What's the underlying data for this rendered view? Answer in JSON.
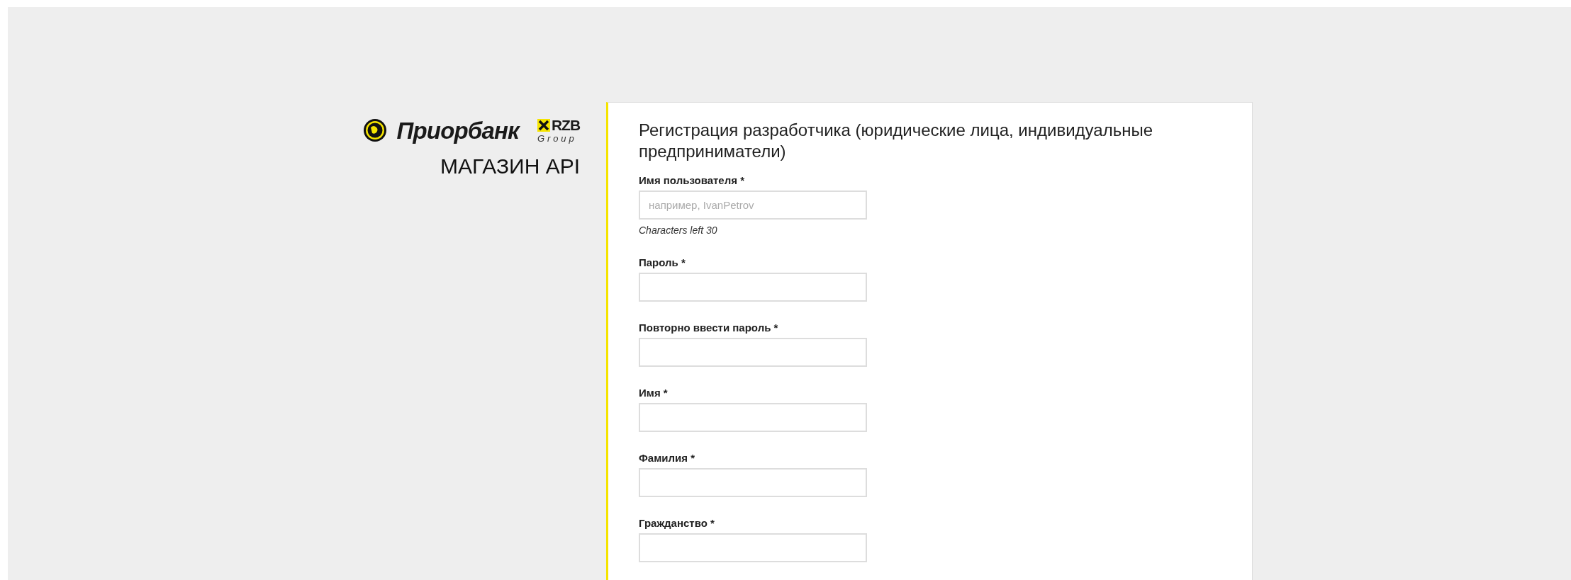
{
  "brand": {
    "name": "Приорбанк",
    "partner": "RZB",
    "partner_sub": "Group",
    "store_title": "МАГАЗИН API"
  },
  "form": {
    "title": "Регистрация разработчика (юридические лица, индивидуальные предприниматели)",
    "fields": [
      {
        "label": "Имя пользователя *",
        "placeholder": "например, IvanPetrov",
        "hint": "Characters left 30"
      },
      {
        "label": "Пароль *"
      },
      {
        "label": "Повторно ввести пароль *"
      },
      {
        "label": "Имя *"
      },
      {
        "label": "Фамилия *"
      },
      {
        "label": "Гражданство *"
      }
    ]
  }
}
